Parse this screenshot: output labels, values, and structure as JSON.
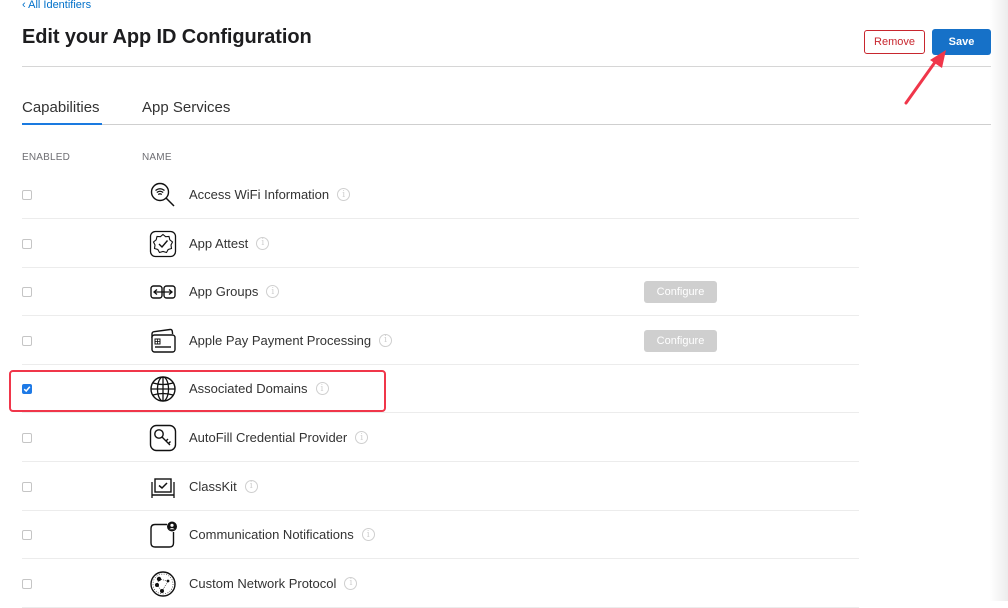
{
  "header": {
    "back_link": "‹ All Identifiers",
    "title": "Edit your App ID Configuration",
    "remove_label": "Remove",
    "save_label": "Save"
  },
  "tabs": [
    {
      "label": "Capabilities",
      "active": true
    },
    {
      "label": "App Services",
      "active": false
    }
  ],
  "table": {
    "columns": [
      "ENABLED",
      "NAME"
    ],
    "configure_label": "Configure",
    "info_glyph": "i",
    "rows": [
      {
        "name": "Access WiFi Information",
        "icon": "wifi-search-icon",
        "enabled": false,
        "configure": false
      },
      {
        "name": "App Attest",
        "icon": "app-attest-badge-icon",
        "enabled": false,
        "configure": false
      },
      {
        "name": "App Groups",
        "icon": "app-groups-icon",
        "enabled": false,
        "configure": true
      },
      {
        "name": "Apple Pay Payment Processing",
        "icon": "apple-pay-cards-icon",
        "enabled": false,
        "configure": true
      },
      {
        "name": "Associated Domains",
        "icon": "globe-icon",
        "enabled": true,
        "configure": false
      },
      {
        "name": "AutoFill Credential Provider",
        "icon": "key-icon",
        "enabled": false,
        "configure": false
      },
      {
        "name": "ClassKit",
        "icon": "classkit-icon",
        "enabled": false,
        "configure": false
      },
      {
        "name": "Communication Notifications",
        "icon": "communication-notification-icon",
        "enabled": false,
        "configure": false
      },
      {
        "name": "Custom Network Protocol",
        "icon": "network-protocol-icon",
        "enabled": false,
        "configure": false
      }
    ]
  },
  "annotations": {
    "highlight_color": "#f0364a",
    "highlighted_row": "Associated Domains",
    "arrow_target": "Save"
  },
  "colors": {
    "accent": "#1671c8",
    "danger": "#c8262e",
    "link": "#0070c9"
  }
}
